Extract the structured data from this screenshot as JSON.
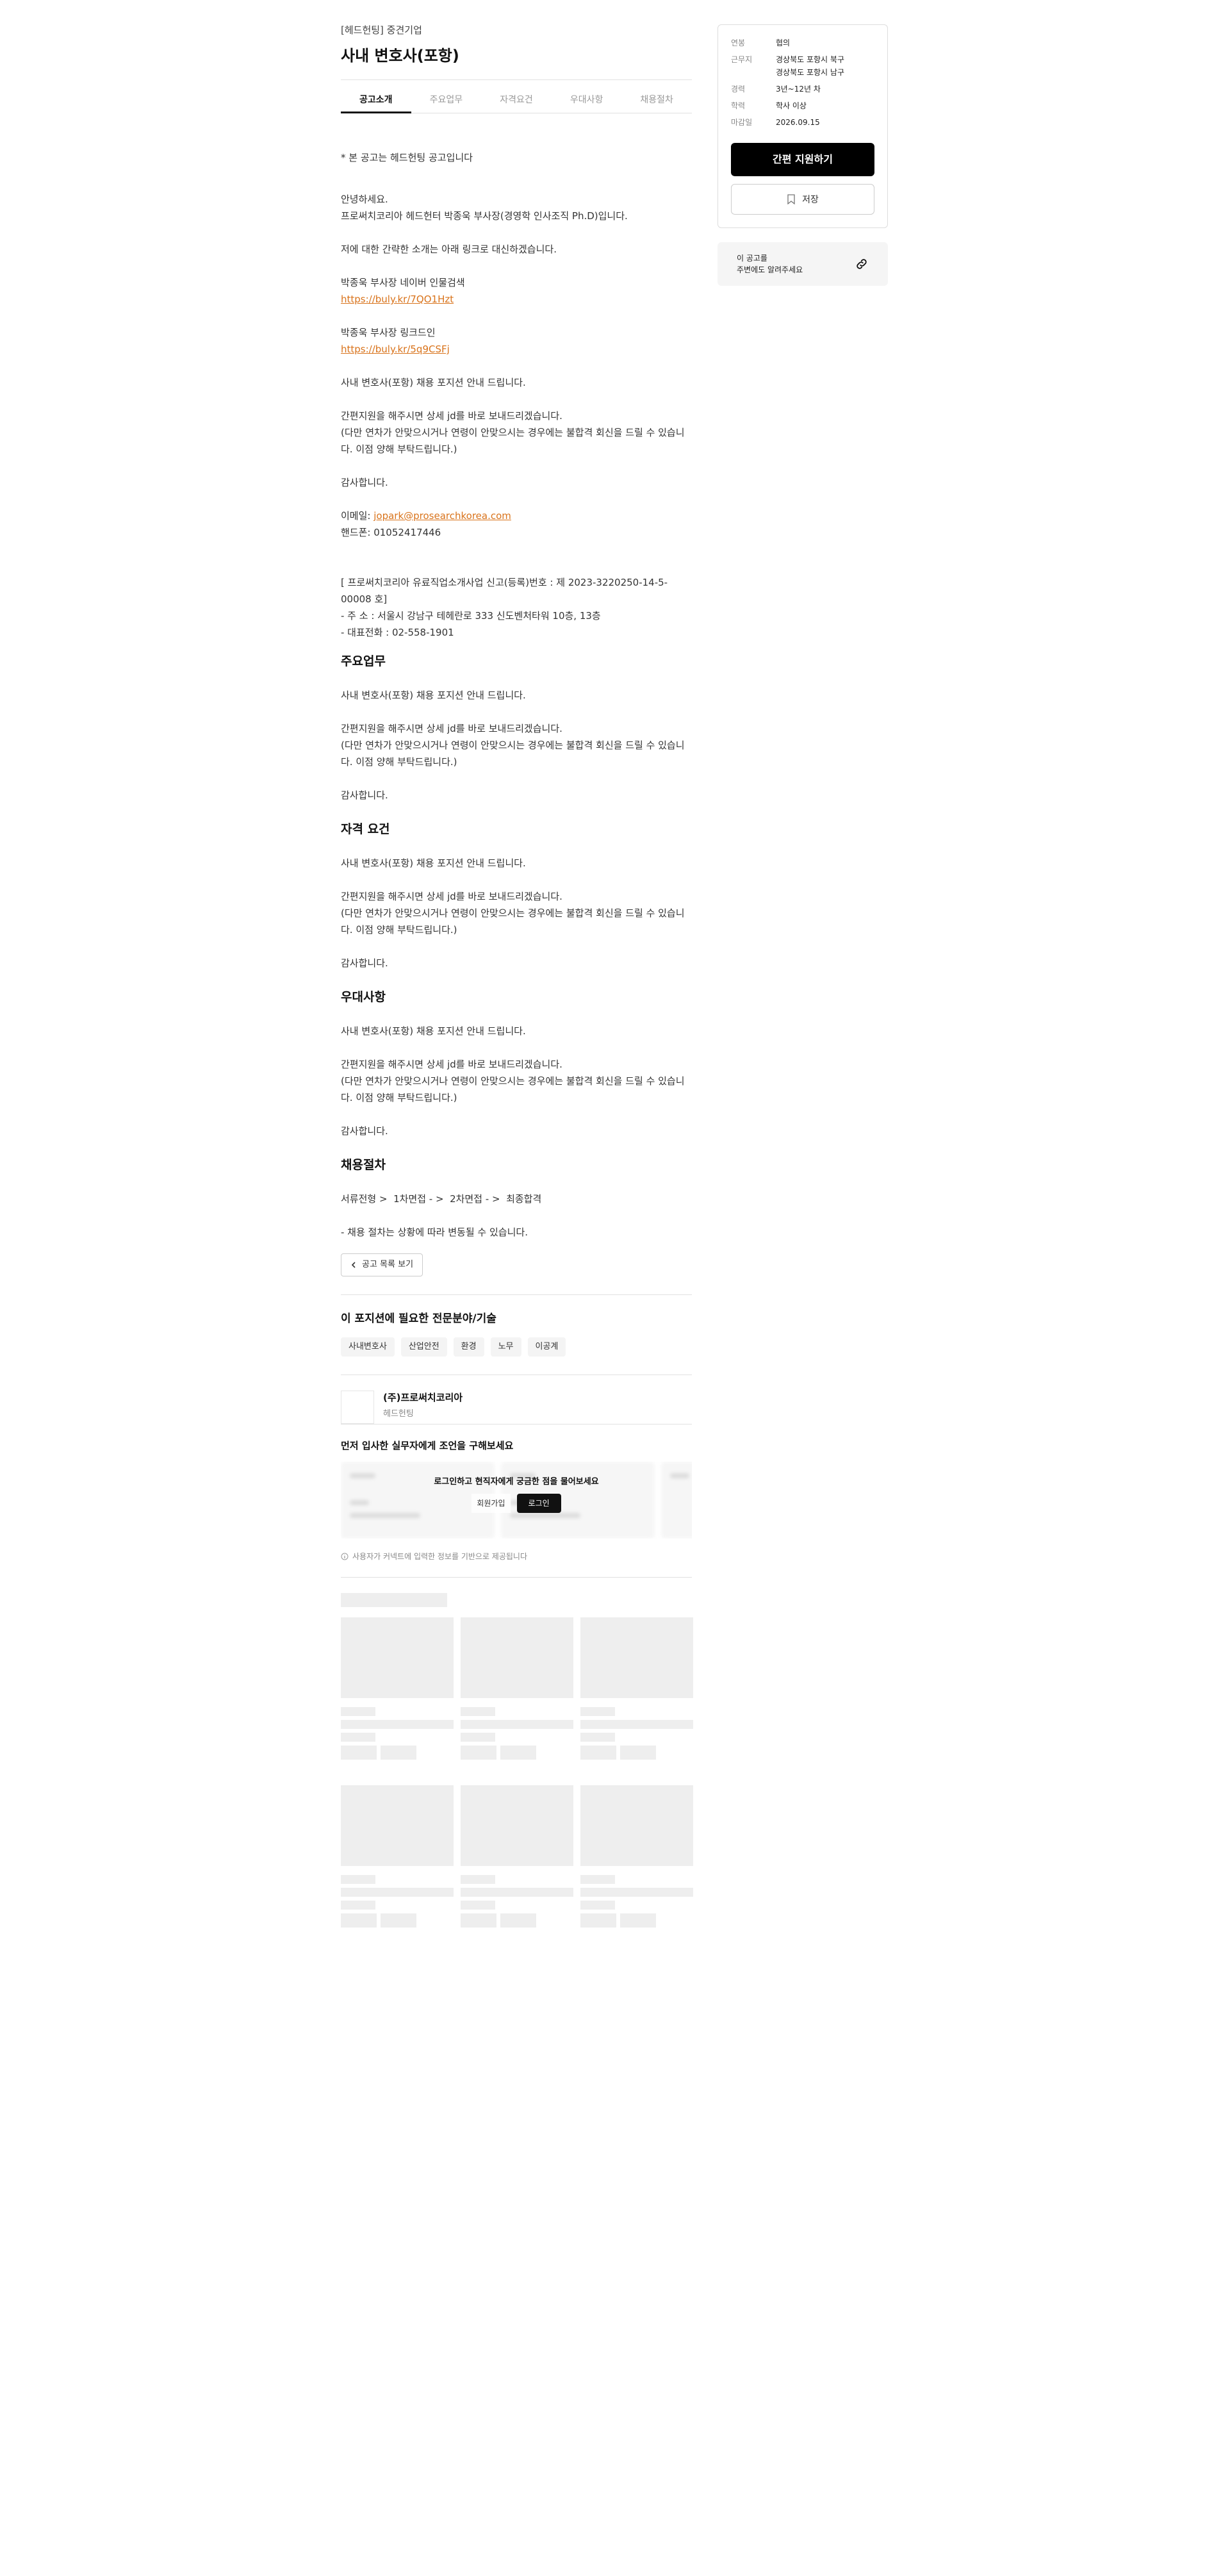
{
  "job": {
    "company_line": "[헤드헌팅] 중견기업",
    "title": "사내 변호사(포항)"
  },
  "tabs": [
    {
      "label": "공고소개"
    },
    {
      "label": "주요업무"
    },
    {
      "label": "자격요건"
    },
    {
      "label": "우대사항"
    },
    {
      "label": "채용절차"
    }
  ],
  "intro": {
    "notice": "* 본 공고는 헤드헌팅 공고입니다",
    "greeting": "안녕하세요.\n프로써치코리아 헤드헌터 박종욱 부사장(경영학 인사조직 Ph.D)입니다.",
    "intro_line": "저에 대한 간략한 소개는 아래 링크로 대신하겠습니다.",
    "naver_label": "박종욱 부사장 네이버 인물검색",
    "naver_link": "https://buly.kr/7QO1Hzt",
    "linkedin_label": "박종욱 부사장 링크드인",
    "linkedin_link": "https://buly.kr/5q9CSFj",
    "position_line": "사내 변호사(포항) 채용 포지션 안내 드립니다.",
    "request": "간편지원을 해주시면 상세 jd를 바로 보내드리겠습니다.\n(다만 연차가 안맞으시거나 연령이 안맞으시는 경우에는 불합격 회신을 드릴 수 있습니다. 이점 양해 부탁드립니다.)",
    "thanks": "감사합니다.",
    "email_label": "이메일: ",
    "email": "jopark@prosearchkorea.com",
    "phone": "핸드폰: 01052417446",
    "registration": "[ 프로써치코리아 유료직업소개사업 신고(등록)번호 : 제 2023-3220250-14-5-00008 호]\n- 주 소 : 서울시 강남구 테헤란로 333 신도벤처타워 10층, 13층\n- 대표전화 : 02-558-1901"
  },
  "sections": {
    "duties": {
      "title": "주요업무",
      "line1": "사내 변호사(포항) 채용 포지션 안내 드립니다.",
      "line2": "간편지원을 해주시면 상세 jd를 바로 보내드리겠습니다.\n(다만 연차가 안맞으시거나 연령이 안맞으시는 경우에는 불합격 회신을 드릴 수 있습니다. 이점 양해 부탁드립니다.)",
      "line3": "감사합니다."
    },
    "requirements": {
      "title": "자격 요건",
      "line1": "사내 변호사(포항) 채용 포지션 안내 드립니다.",
      "line2": "간편지원을 해주시면 상세 jd를 바로 보내드리겠습니다.\n(다만 연차가 안맞으시거나 연령이 안맞으시는 경우에는 불합격 회신을 드릴 수 있습니다. 이점 양해 부탁드립니다.)",
      "line3": "감사합니다."
    },
    "preferred": {
      "title": "우대사항",
      "line1": "사내 변호사(포항) 채용 포지션 안내 드립니다.",
      "line2": "간편지원을 해주시면 상세 jd를 바로 보내드리겠습니다.\n(다만 연차가 안맞으시거나 연령이 안맞으시는 경우에는 불합격 회신을 드릴 수 있습니다. 이점 양해 부탁드립니다.)",
      "line3": "감사합니다."
    },
    "process": {
      "title": "채용절차",
      "steps": "서류전형 >  1차면접 - >  2차면접 - >  최종합격",
      "note": "- 채용 절차는 상황에 따라 변동될 수 있습니다."
    }
  },
  "back_button": "공고 목록 보기",
  "skills": {
    "title": "이 포지션에 필요한 전문분야/기술",
    "chips": [
      "사내변호사",
      "산업안전",
      "환경",
      "노무",
      "이공계"
    ]
  },
  "company": {
    "name": "(주)프로써치코리아",
    "type": "헤드헌팅"
  },
  "advice": {
    "title": "먼저 입사한 실무자에게 조언을 구해보세요",
    "message": "로그인하고 현직자에게 궁금한 점을 물어보세요",
    "signup": "회원가입",
    "login": "로그인",
    "note": "사용자가 커넥트에 입력한 정보를 기반으로 제공됩니다"
  },
  "sidebar": {
    "rows": [
      {
        "label": "연봉",
        "value": "협의"
      },
      {
        "label": "근무지",
        "value": "경상북도 포항시 북구\n경상북도 포항시 남구"
      },
      {
        "label": "경력",
        "value": "3년~12년 차"
      },
      {
        "label": "학력",
        "value": "학사 이상"
      },
      {
        "label": "마감일",
        "value": "2026.09.15"
      }
    ],
    "apply": "간편 지원하기",
    "save": "저장",
    "share_text": "이 공고를\n주변에도 알려주세요"
  },
  "colors": {
    "link": "#d9731b",
    "primary": "#000000",
    "skeleton": "#eeeeee"
  }
}
